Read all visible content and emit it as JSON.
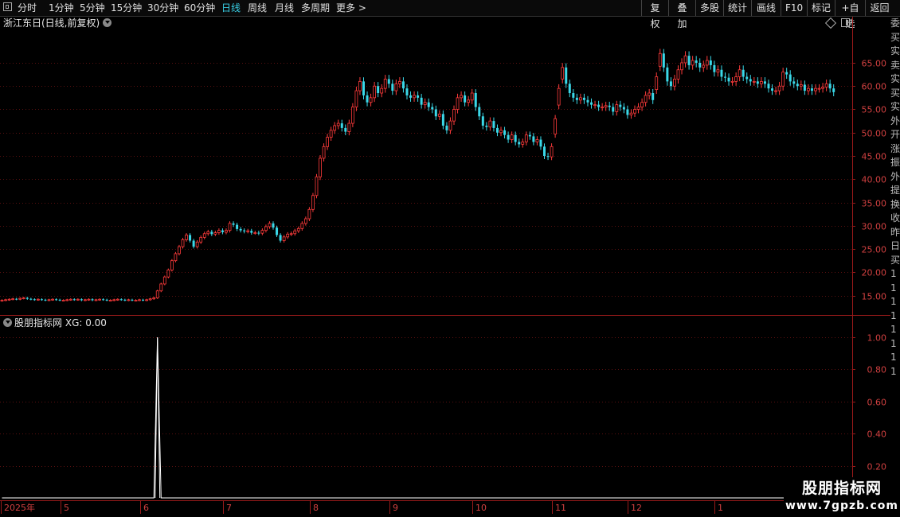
{
  "toolbar": {
    "items": [
      "分时",
      "1分钟",
      "5分钟",
      "15分钟",
      "30分钟",
      "60分钟",
      "日线",
      "周线",
      "月线",
      "多周期",
      "更多 >"
    ],
    "active": "日线",
    "right_buttons": [
      "复权",
      "叠加",
      "多股",
      "统计",
      "画线",
      "F10",
      "标记",
      "+自选",
      "返回"
    ]
  },
  "chart_title": "浙江东日(日线,前复权)",
  "indicator": {
    "name": "股朋指标网",
    "value_label": "XG: 0.00"
  },
  "side_strip": [
    "委",
    "买",
    "实",
    "卖",
    "实",
    "买",
    "实",
    "外",
    "开",
    "涨",
    "振",
    "外",
    "提",
    "换",
    "收",
    "昨",
    "日",
    "买",
    "1",
    "1",
    "1",
    "1",
    "1",
    "1",
    "1",
    "1"
  ],
  "watermark": {
    "line1": "股朋指标网",
    "line2": "www.7gpzb.com"
  },
  "colors": {
    "up": "#ff3b3b",
    "down": "#3ad8e8",
    "axis": "#9a1a1a",
    "grid": "#5a1010",
    "indicator_line": "#ffffff"
  },
  "chart_data": {
    "type": "candlestick",
    "price_axis": {
      "ylim": [
        11,
        72
      ],
      "ticks": [
        15,
        20,
        25,
        30,
        35,
        40,
        45,
        50,
        55,
        60,
        65
      ],
      "tick_labels": [
        "15.00",
        "20.00",
        "25.00",
        "30.00",
        "35.00",
        "40.00",
        "45.00",
        "50.00",
        "55.00",
        "60.00",
        "65.00"
      ]
    },
    "indicator_axis": {
      "ylim": [
        0,
        1.05
      ],
      "ticks": [
        0.2,
        0.4,
        0.6,
        0.8,
        1.0
      ],
      "tick_labels": [
        "0.20",
        "0.40",
        "0.60",
        "0.80",
        "1.00"
      ]
    },
    "x_axis": {
      "month_labels": [
        {
          "label": "2025年",
          "index": 0
        },
        {
          "label": "5",
          "index": 17
        },
        {
          "label": "6",
          "index": 39
        },
        {
          "label": "7",
          "index": 62
        },
        {
          "label": "8",
          "index": 86
        },
        {
          "label": "9",
          "index": 108
        },
        {
          "label": "10",
          "index": 131
        },
        {
          "label": "11",
          "index": 153
        },
        {
          "label": "12",
          "index": 174
        },
        {
          "label": "1",
          "index": 198
        }
      ]
    },
    "closes": [
      14,
      14.1,
      14.2,
      14.3,
      14.2,
      14.4,
      14.5,
      14.3,
      14.2,
      14.1,
      14.2,
      14.1,
      14,
      14.1,
      14.2,
      14.1,
      14,
      14,
      14.1,
      14.2,
      14.1,
      14.2,
      14,
      14.1,
      14.2,
      14,
      14.1,
      14.2,
      14.1,
      14,
      14,
      14.1,
      14.2,
      14.1,
      14,
      14.1,
      14,
      14,
      14.1,
      14,
      14.1,
      14.3,
      14.5,
      16,
      17.5,
      19,
      20.5,
      22.5,
      24,
      25.5,
      27,
      28,
      26.8,
      25.5,
      26.5,
      27.5,
      28.3,
      28.7,
      28.2,
      28.5,
      29,
      28.6,
      29,
      30.5,
      30.2,
      29.3,
      29,
      28.8,
      28.9,
      28.5,
      28.5,
      28.4,
      29,
      29.8,
      30.5,
      29.6,
      28,
      26.8,
      27.6,
      28.2,
      28.3,
      28.9,
      29.4,
      30.5,
      31.5,
      33.5,
      36.5,
      40.5,
      44.5,
      47,
      49,
      50.5,
      51.5,
      52,
      51,
      50.2,
      52,
      55.5,
      59,
      61,
      58,
      56.5,
      57.5,
      60,
      58.5,
      59.5,
      61.5,
      60.5,
      59,
      60.5,
      61,
      59.5,
      58,
      57.5,
      58,
      57.5,
      56,
      56.5,
      55.5,
      55,
      53.5,
      54,
      51.5,
      50.5,
      52.5,
      55,
      57.5,
      58,
      56.5,
      57,
      58.5,
      55.5,
      53.5,
      51.5,
      51.2,
      52.5,
      51,
      50,
      50.5,
      49.5,
      48.5,
      49.5,
      48,
      47.5,
      48,
      49.5,
      49.2,
      48,
      48.5,
      47,
      45,
      44.8,
      47,
      53,
      59.5,
      64,
      60.5,
      58.5,
      57.5,
      57,
      57.5,
      57,
      56.5,
      56,
      56,
      55.5,
      55.5,
      55.8,
      55.5,
      54.5,
      56,
      55.5,
      55,
      53.8,
      54.2,
      55,
      55.5,
      56.5,
      58,
      58.5,
      57,
      62,
      67,
      64,
      61,
      60,
      61.5,
      63.5,
      65,
      66.5,
      64.5,
      65.5,
      65,
      64,
      64.5,
      65.5,
      64.5,
      63,
      63.5,
      62,
      61.8,
      61,
      61,
      62,
      63.5,
      62,
      61.5,
      61,
      61,
      60.5,
      61,
      60.5,
      59.5,
      59,
      59,
      60,
      63,
      62.5,
      61,
      60.5,
      60,
      60.3,
      59,
      59.5,
      59,
      59.5,
      59.5,
      59.8,
      60.5,
      59.5,
      58.7
    ]
  }
}
